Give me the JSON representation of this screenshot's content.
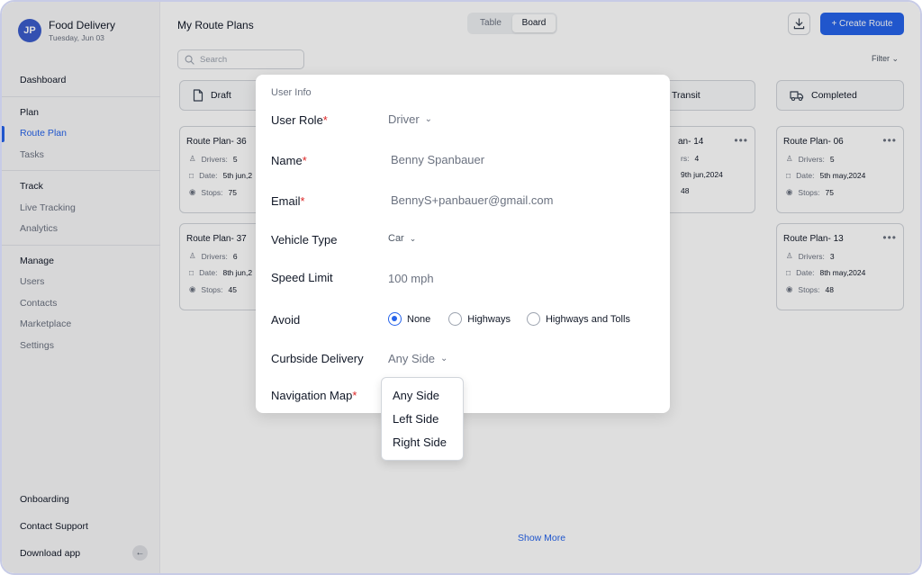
{
  "app": {
    "initials": "JP",
    "name": "Food Delivery",
    "date": "Tuesday, Jun 03"
  },
  "sidebar": {
    "dashboard": "Dashboard",
    "plan_head": "Plan",
    "route_plan": "Route Plan",
    "tasks": "Tasks",
    "track_head": "Track",
    "live_tracking": "Live Tracking",
    "analytics": "Analytics",
    "manage_head": "Manage",
    "users": "Users",
    "contacts": "Contacts",
    "marketplace": "Marketplace",
    "settings": "Settings",
    "onboarding": "Onboarding",
    "contact_support": "Contact Support",
    "download_app": "Download app"
  },
  "header": {
    "title": "My Route Plans",
    "view_table": "Table",
    "view_board": "Board",
    "create": "+ Create Route",
    "search_placeholder": "Search",
    "filter": "Filter"
  },
  "columns": {
    "draft": "Draft",
    "transit": "Transit",
    "completed": "Completed"
  },
  "cards": {
    "c36": {
      "title": "Route Plan- 36",
      "drivers": "Drivers: ",
      "drivers_val": "5",
      "date": "Date: ",
      "date_val": "5th jun,2",
      "stops": "Stops: ",
      "stops_val": "75"
    },
    "c37": {
      "title": "Route Plan- 37",
      "drivers": "Drivers: ",
      "drivers_val": "6",
      "date": "Date: ",
      "date_val": "8th jun,2",
      "stops": "Stops: ",
      "stops_val": "45"
    },
    "c14": {
      "title": "an- 14",
      "drivers": "rs: ",
      "drivers_val": "4",
      "date": "",
      "date_val": "9th jun,2024",
      "stops": "",
      "stops_val": "48"
    },
    "c06": {
      "title": "Route Plan- 06",
      "drivers": "Drivers: ",
      "drivers_val": "5",
      "date": "Date: ",
      "date_val": "5th may,2024",
      "stops": "Stops: ",
      "stops_val": "75"
    },
    "c13": {
      "title": "Route Plan- 13",
      "drivers": "Drivers: ",
      "drivers_val": "3",
      "date": "Date: ",
      "date_val": "8th may,2024",
      "stops": "Stops: ",
      "stops_val": "48"
    }
  },
  "show_more": "Show More",
  "modal": {
    "section": "User Info",
    "user_role_label": "User Role",
    "user_role_value": "Driver",
    "name_label": "Name",
    "name_value": "Benny Spanbauer",
    "email_label": "Email",
    "email_value": "BennyS+panbauer@gmail.com",
    "vehicle_label": "Vehicle Type",
    "vehicle_value": "Car",
    "speed_label": "Speed Limit",
    "speed_value": "100 mph",
    "avoid_label": "Avoid",
    "avoid_options": [
      "None",
      "Highways",
      "Highways and Tolls"
    ],
    "avoid_selected": "None",
    "curbside_label": "Curbside Delivery",
    "curbside_value": "Any Side",
    "navmap_label": "Navigation Map",
    "required_mark": "*"
  },
  "curbside_dropdown": [
    "Any Side",
    "Left Side",
    "Right Side"
  ],
  "colors": {
    "accent": "#2563eb",
    "required": "#dc2626",
    "avatar": "#3b5ccc"
  }
}
